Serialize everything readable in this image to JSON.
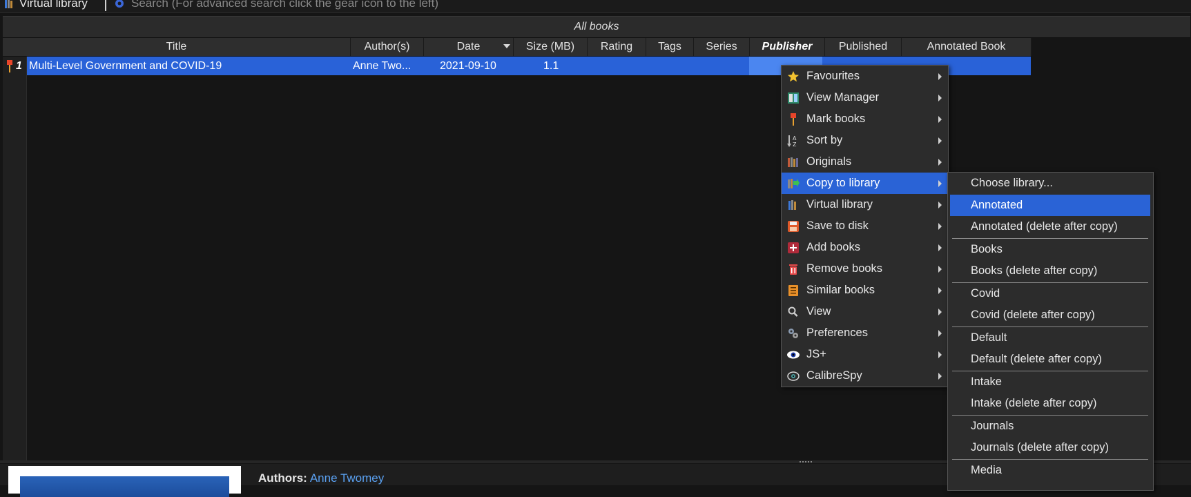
{
  "toolbar": {
    "virtual_library_label": "Virtual library",
    "search_placeholder": "Search (For advanced search click the gear icon to the left)"
  },
  "library": {
    "title": "All books"
  },
  "table": {
    "columns": [
      "Title",
      "Author(s)",
      "Date",
      "Size (MB)",
      "Rating",
      "Tags",
      "Series",
      "Publisher",
      "Published",
      "Annotated Book"
    ],
    "sorted_column": "Publisher",
    "rows": [
      {
        "number": "1",
        "title": "Multi-Level Government and COVID-19",
        "authors": "Anne Two...",
        "date": "2021-09-10",
        "size": "1.1"
      }
    ]
  },
  "context_menu": {
    "items": [
      {
        "label": "Favourites",
        "icon": "star-icon"
      },
      {
        "label": "View Manager",
        "icon": "view-manager-icon"
      },
      {
        "label": "Mark books",
        "icon": "pin-icon"
      },
      {
        "label": "Sort by",
        "icon": "sort-az-icon"
      },
      {
        "label": "Originals",
        "icon": "originals-icon"
      },
      {
        "label": "Copy to library",
        "icon": "copy-library-icon"
      },
      {
        "label": "Virtual library",
        "icon": "virtual-library-icon"
      },
      {
        "label": "Save to disk",
        "icon": "save-disk-icon"
      },
      {
        "label": "Add books",
        "icon": "add-books-icon"
      },
      {
        "label": "Remove books",
        "icon": "trash-icon"
      },
      {
        "label": "Similar books",
        "icon": "similar-books-icon"
      },
      {
        "label": "View",
        "icon": "magnifier-icon"
      },
      {
        "label": "Preferences",
        "icon": "preferences-icon"
      },
      {
        "label": "JS+",
        "icon": "eye-icon"
      },
      {
        "label": "CalibreSpy",
        "icon": "spy-eye-icon"
      }
    ],
    "highlighted": "Copy to library"
  },
  "copy_submenu": {
    "items": [
      "Choose library...",
      "Annotated",
      "Annotated (delete after copy)",
      "Books",
      "Books (delete after copy)",
      "Covid",
      "Covid (delete after copy)",
      "Default",
      "Default (delete after copy)",
      "Intake",
      "Intake (delete after copy)",
      "Journals",
      "Journals (delete after copy)",
      "Media"
    ],
    "highlighted": "Annotated"
  },
  "details": {
    "authors_label": "Authors:",
    "authors_value": "Anne Twomey"
  },
  "colors": {
    "selection": "#2a63d6",
    "link": "#5aa0f0",
    "background": "#151515"
  }
}
